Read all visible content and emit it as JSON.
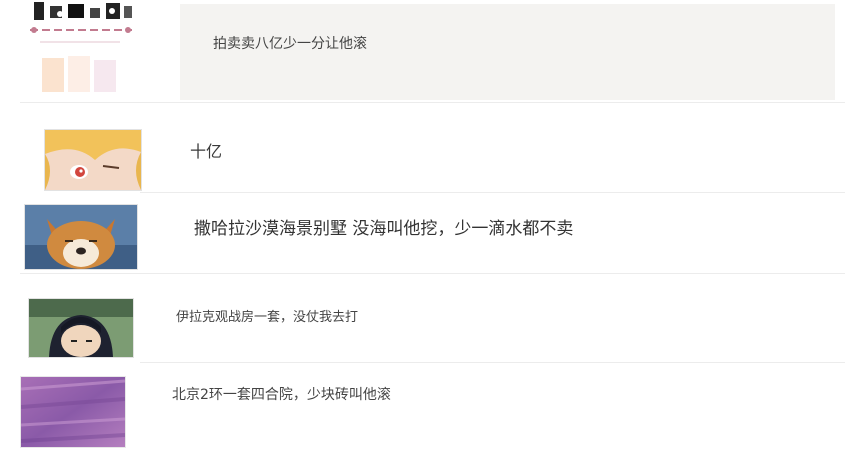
{
  "comments": [
    {
      "avatar_icon": "decorative-ornament-avatar-icon",
      "text": "拍卖卖八亿少一分让他滚"
    },
    {
      "avatar_icon": "anime-blonde-girl-avatar-icon",
      "text": "十亿"
    },
    {
      "avatar_icon": "shiba-dog-avatar-icon",
      "text": "撒哈拉沙漠海景别墅 没海叫他挖，少一滴水都不卖"
    },
    {
      "avatar_icon": "anime-dark-hair-boy-avatar-icon",
      "text": "伊拉克观战房一套，没仗我去打"
    },
    {
      "avatar_icon": "purple-texture-avatar-icon",
      "text": "北京2环一套四合院，少块砖叫他滚"
    }
  ],
  "colors": {
    "highlight_bubble": "#f4f3f1",
    "divider": "#ececec",
    "text": "#3a3a3a"
  }
}
